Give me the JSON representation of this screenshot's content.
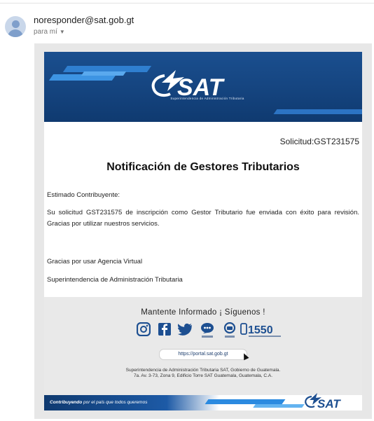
{
  "email": {
    "sender": "noresponder@sat.gob.gt",
    "recipient": "para mí"
  },
  "header": {
    "logo_text": "SAT",
    "logo_subtitle": "Superintendencia de Administración Tributaria"
  },
  "body": {
    "solicitud": "Solicitud:GST231575",
    "title": "Notificación de Gestores Tributarios",
    "greeting": "Estimado Contribuyente:",
    "message": "Su solicitud GST231575 de inscripción como Gestor Tributario fue enviada con éxito para revisión. Gracias por utilizar nuestros servicios.",
    "thanks": "Gracias por usar Agencia Virtual",
    "org": "Superintendencia de Administración Tributaria"
  },
  "footer": {
    "follow": "Mantente Informado ¡ Síguenos !",
    "social_icons": [
      "instagram-icon",
      "facebook-icon",
      "twitter-icon",
      "chatbot-icon",
      "tech-icon",
      "phone-1550-icon"
    ],
    "phone": "1550",
    "url": "https://portal.sat.gob.gt",
    "address_line1": "Superintendencia de Administración Tributaria SAT, Gobierno de Guatemala.",
    "address_line2": "7a. Av. 3-73, Zona 9, Edificio Torre SAT Guatemala, Guatemala, C.A.",
    "slogan_bold": "Contribuyendo",
    "slogan_rest": " por el país que todos queremos",
    "logo_text": "SAT"
  },
  "colors": {
    "brand_blue": "#164682",
    "accent_blue": "#2b8ae0",
    "footer_gray": "#e9e9e9"
  }
}
